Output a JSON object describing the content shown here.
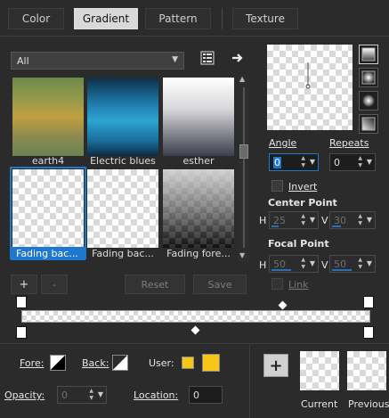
{
  "tabs": [
    {
      "label": "Color",
      "active": false
    },
    {
      "label": "Gradient",
      "active": true
    },
    {
      "label": "Pattern",
      "active": false
    },
    {
      "label": "Texture",
      "active": false
    }
  ],
  "category": {
    "value": "All"
  },
  "gradients": [
    {
      "label": "earth4",
      "selected": false
    },
    {
      "label": "Electric blues",
      "selected": false
    },
    {
      "label": "esther",
      "selected": false
    },
    {
      "label": "Fading bac...",
      "selected": true
    },
    {
      "label": "Fading bac...",
      "selected": false
    },
    {
      "label": "Fading fore...",
      "selected": false
    }
  ],
  "actions": {
    "add": "+",
    "remove": "-",
    "reset": "Reset",
    "save": "Save"
  },
  "angle": {
    "label": "Angle",
    "value": "0"
  },
  "repeats": {
    "label": "Repeats",
    "value": "0"
  },
  "invert": {
    "label": "Invert",
    "checked": false
  },
  "center_point": {
    "label": "Center Point",
    "h_label": "H",
    "h_value": "25",
    "v_label": "V",
    "v_value": "30"
  },
  "focal_point": {
    "label": "Focal Point",
    "h_label": "H",
    "h_value": "50",
    "v_label": "V",
    "v_value": "50"
  },
  "link": {
    "label": "Link",
    "checked": false
  },
  "fore": {
    "label": "Fore:"
  },
  "back": {
    "label": "Back:"
  },
  "user": {
    "label": "User:",
    "color": "#f5c518"
  },
  "opacity": {
    "label": "Opacity:",
    "value": "0"
  },
  "location": {
    "label": "Location:",
    "value": "0"
  },
  "preview": {
    "add_button": "+",
    "current_label": "Current",
    "previous_label": "Previous"
  },
  "colors": {
    "accent": "#1e78d0",
    "panel_bg": "#2b2b2b",
    "user_swatch": "#f5c518"
  }
}
